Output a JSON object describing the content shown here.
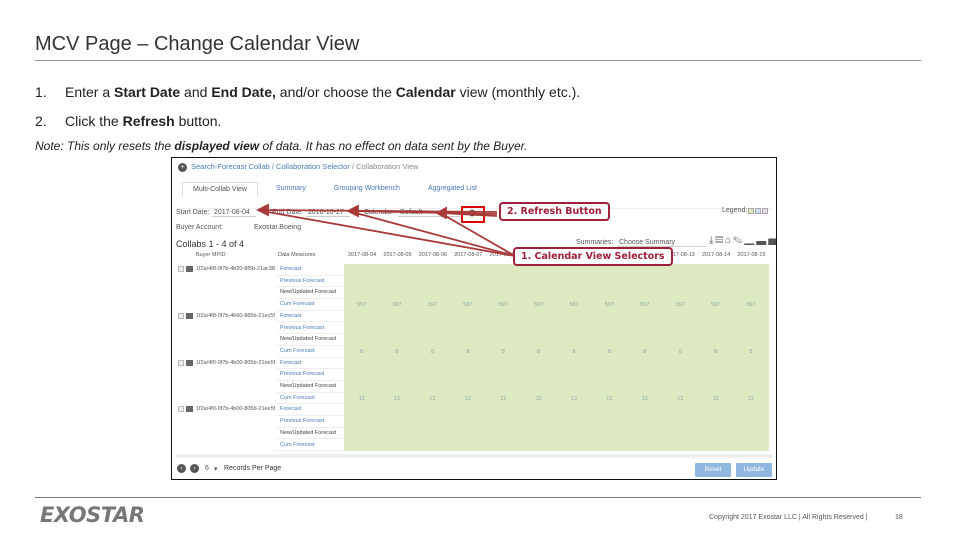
{
  "title": "MCV Page – Change Calendar View",
  "steps": [
    {
      "num": "1.",
      "parts": [
        "Enter a ",
        "Start Date",
        " and ",
        "End Date,",
        " and/or choose the ",
        "Calendar",
        " view (monthly etc.)."
      ]
    },
    {
      "num": "2.",
      "parts": [
        "Click the ",
        "Refresh",
        " button."
      ]
    }
  ],
  "note": {
    "prefix": "Note:  This only resets the ",
    "bold": "displayed view",
    " suffix": "",
    "tail": " of data.  It has no effect on data sent by the Buyer."
  },
  "app": {
    "breadcrumb": {
      "link": "Search-Forecast Collab / Collaboration Selector",
      "current": " / Collaboration View"
    },
    "tabs": [
      "Multi-Collab View",
      "Summary",
      "Grouping Workbench",
      "Aggregated List"
    ],
    "start_label": "Start Date:",
    "start_value": "2017-08-04",
    "end_label": "End Date:",
    "end_value": "2018-10-27",
    "calendar_label": "Calendar:",
    "calendar_value": "Default",
    "legend_label": "Legend:",
    "legend_colors": [
      "#dde9c0",
      "#cfe0f3",
      "#e8d8ef"
    ],
    "buyer_account_label": "Buyer Account:",
    "buyer_account_value": "Exostar.Boeing",
    "collabs_title": "Collabs 1 - 4 of 4",
    "summaries_label": "Summaries:",
    "summaries_value": "Choose Summary",
    "col_buyer": "Buyer MPID",
    "col_measures": "Data Measures",
    "dates": [
      "2017-08-04",
      "2017-08-05",
      "2017-08-06",
      "2017-08-07",
      "2017-08-08",
      "2017-08-09",
      "2017-08-10",
      "2017-08-11",
      "2017-08-12",
      "2017-08-13",
      "2017-08-14",
      "2017-08-15"
    ],
    "collabs": [
      {
        "id": "1f2a/4f8-0f7b-4b20-8f5b-21ac38",
        "measures": [
          "Forecast",
          "Previous Forecast",
          "New/Updated Forecast",
          "Cum Forecast"
        ],
        "cum": "597"
      },
      {
        "id": "1f2a/4f8-0f7b-4b60-865b-21ec5f",
        "measures": [
          "Forecast",
          "Previous Forecast",
          "New/Updated Forecast",
          "Cum Forecast"
        ],
        "cum": "8"
      },
      {
        "id": "1f2a/4f0-0f7b-4b00-805b-21ee5f",
        "measures": [
          "Forecast",
          "Previous Forecast",
          "New/Updated Forecast",
          "Cum Forecast"
        ],
        "cum": "12"
      },
      {
        "id": "1f2a/4f0-0f7b-4b00-805b-21ee5f",
        "measures": [
          "Forecast",
          "Previous Forecast",
          "New/Updated Forecast",
          "Cum Forecast"
        ],
        "cum": ""
      }
    ],
    "records_value": "6",
    "records_label": "Records Per Page",
    "reset": "Reset",
    "update": "Update"
  },
  "callouts": {
    "refresh": "2. Refresh Button",
    "calendar": "1. Calendar View Selectors"
  },
  "accent": "#a0203a",
  "footer": {
    "logo": "EXOSTAR",
    "copyright": "Copyright 2017 Exostar LLC | All Rights Reserved |",
    "page": "18"
  }
}
